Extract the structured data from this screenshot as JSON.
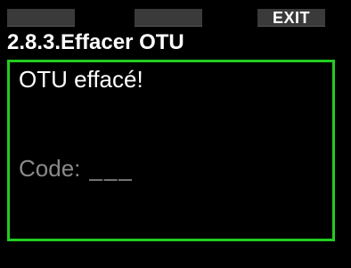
{
  "softkeys": {
    "left_label": "",
    "middle_label": "",
    "right_label": "EXIT"
  },
  "screen": {
    "title": "2.8.3.Effacer OTU"
  },
  "panel": {
    "message": "OTU effacé!",
    "code_label": "Code:",
    "code_value": "___"
  },
  "colors": {
    "background": "#000000",
    "panel_border": "#22cc22",
    "softkey_bg": "#3a3a3a",
    "dim_text": "#8a8a8a"
  }
}
